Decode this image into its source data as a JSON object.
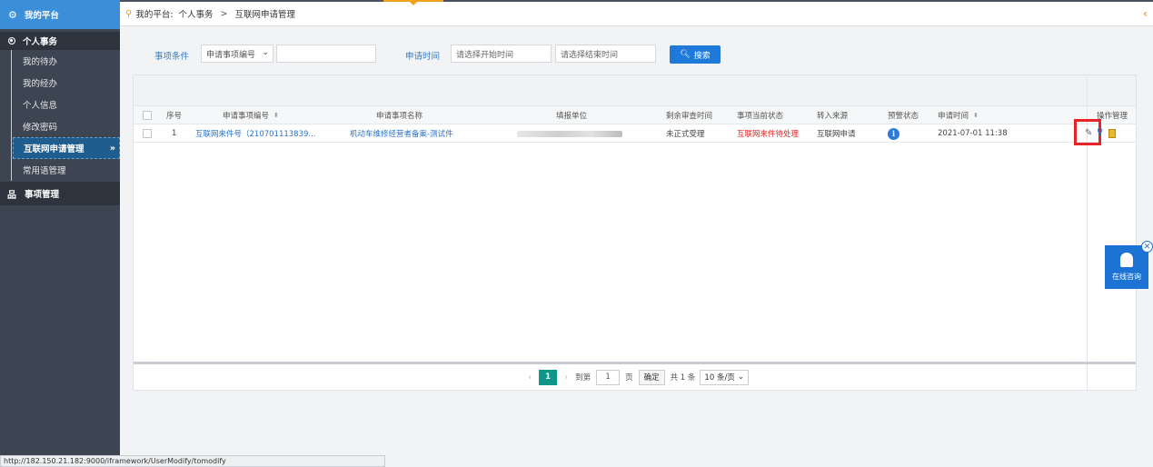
{
  "sidebar": {
    "header": "我的平台",
    "group1": "个人事务",
    "items": [
      {
        "label": "我的待办"
      },
      {
        "label": "我的经办"
      },
      {
        "label": "个人信息"
      },
      {
        "label": "修改密码"
      },
      {
        "label": "互联网申请管理",
        "active": true
      },
      {
        "label": "常用语管理"
      }
    ],
    "group2": "事项管理"
  },
  "breadcrumb": {
    "root": "我的平台:",
    "level1": "个人事务",
    "separator": ">",
    "level2": "互联网申请管理"
  },
  "search": {
    "cond_label": "事项条件",
    "cond_select": "申请事项编号",
    "cond_input_value": "",
    "time_label": "申请时间",
    "start_placeholder": "请选择开始时间",
    "end_placeholder": "请选择结束时间",
    "button": "搜索"
  },
  "table": {
    "headers": {
      "seq": "序号",
      "code": "申请事项编号",
      "name": "申请事项名称",
      "unit": "填报单位",
      "remain": "剩余审查时间",
      "state": "事项当前状态",
      "source": "转入来源",
      "warn": "预警状态",
      "time": "申请时间",
      "ops": "操作管理"
    },
    "rows": [
      {
        "seq": "1",
        "code": "互联网来件号（210701113839...",
        "name": "机动车维修经营者备案-测试件",
        "remain": "未正式受理",
        "state": "互联网来件待处理",
        "source": "互联网申请",
        "time": "2021-07-01 11:38"
      }
    ]
  },
  "pager": {
    "current": "1",
    "goto_label": "到第",
    "goto_value": "1",
    "page_unit": "页",
    "confirm": "确定",
    "total": "共 1 条",
    "page_size": "10 条/页"
  },
  "consult": {
    "label": "在线咨询"
  },
  "statusbar": {
    "url": "http://182.150.21.182:9000/iframework/UserModify/tomodify"
  },
  "colors": {
    "accent": "#3b8ed8",
    "sidebar": "#3d4552",
    "active": "#1f5d8f",
    "link": "#2a72c6",
    "alert": "#e02626",
    "page": "#0e9688"
  }
}
